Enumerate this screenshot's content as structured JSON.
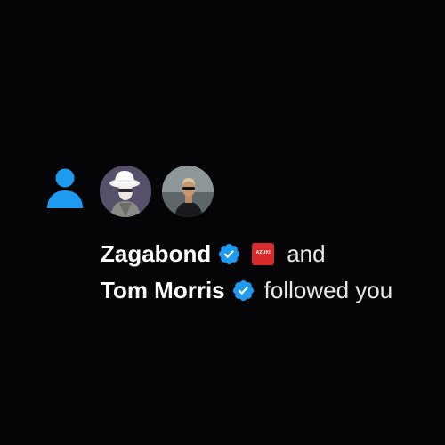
{
  "notification": {
    "type_icon": "person-icon",
    "accent_color": "#1d9bf0",
    "avatars": [
      {
        "icon": "avatar-bucket-hat-character"
      },
      {
        "icon": "avatar-man-sunglasses"
      }
    ],
    "user1": {
      "name": "Zagabond",
      "verified_icon": "verified-check-icon",
      "affiliate_badge_text": "AZUKI"
    },
    "connector": "and",
    "user2": {
      "name": "Tom Morris",
      "verified_icon": "verified-check-icon"
    },
    "action_text": "followed you"
  }
}
